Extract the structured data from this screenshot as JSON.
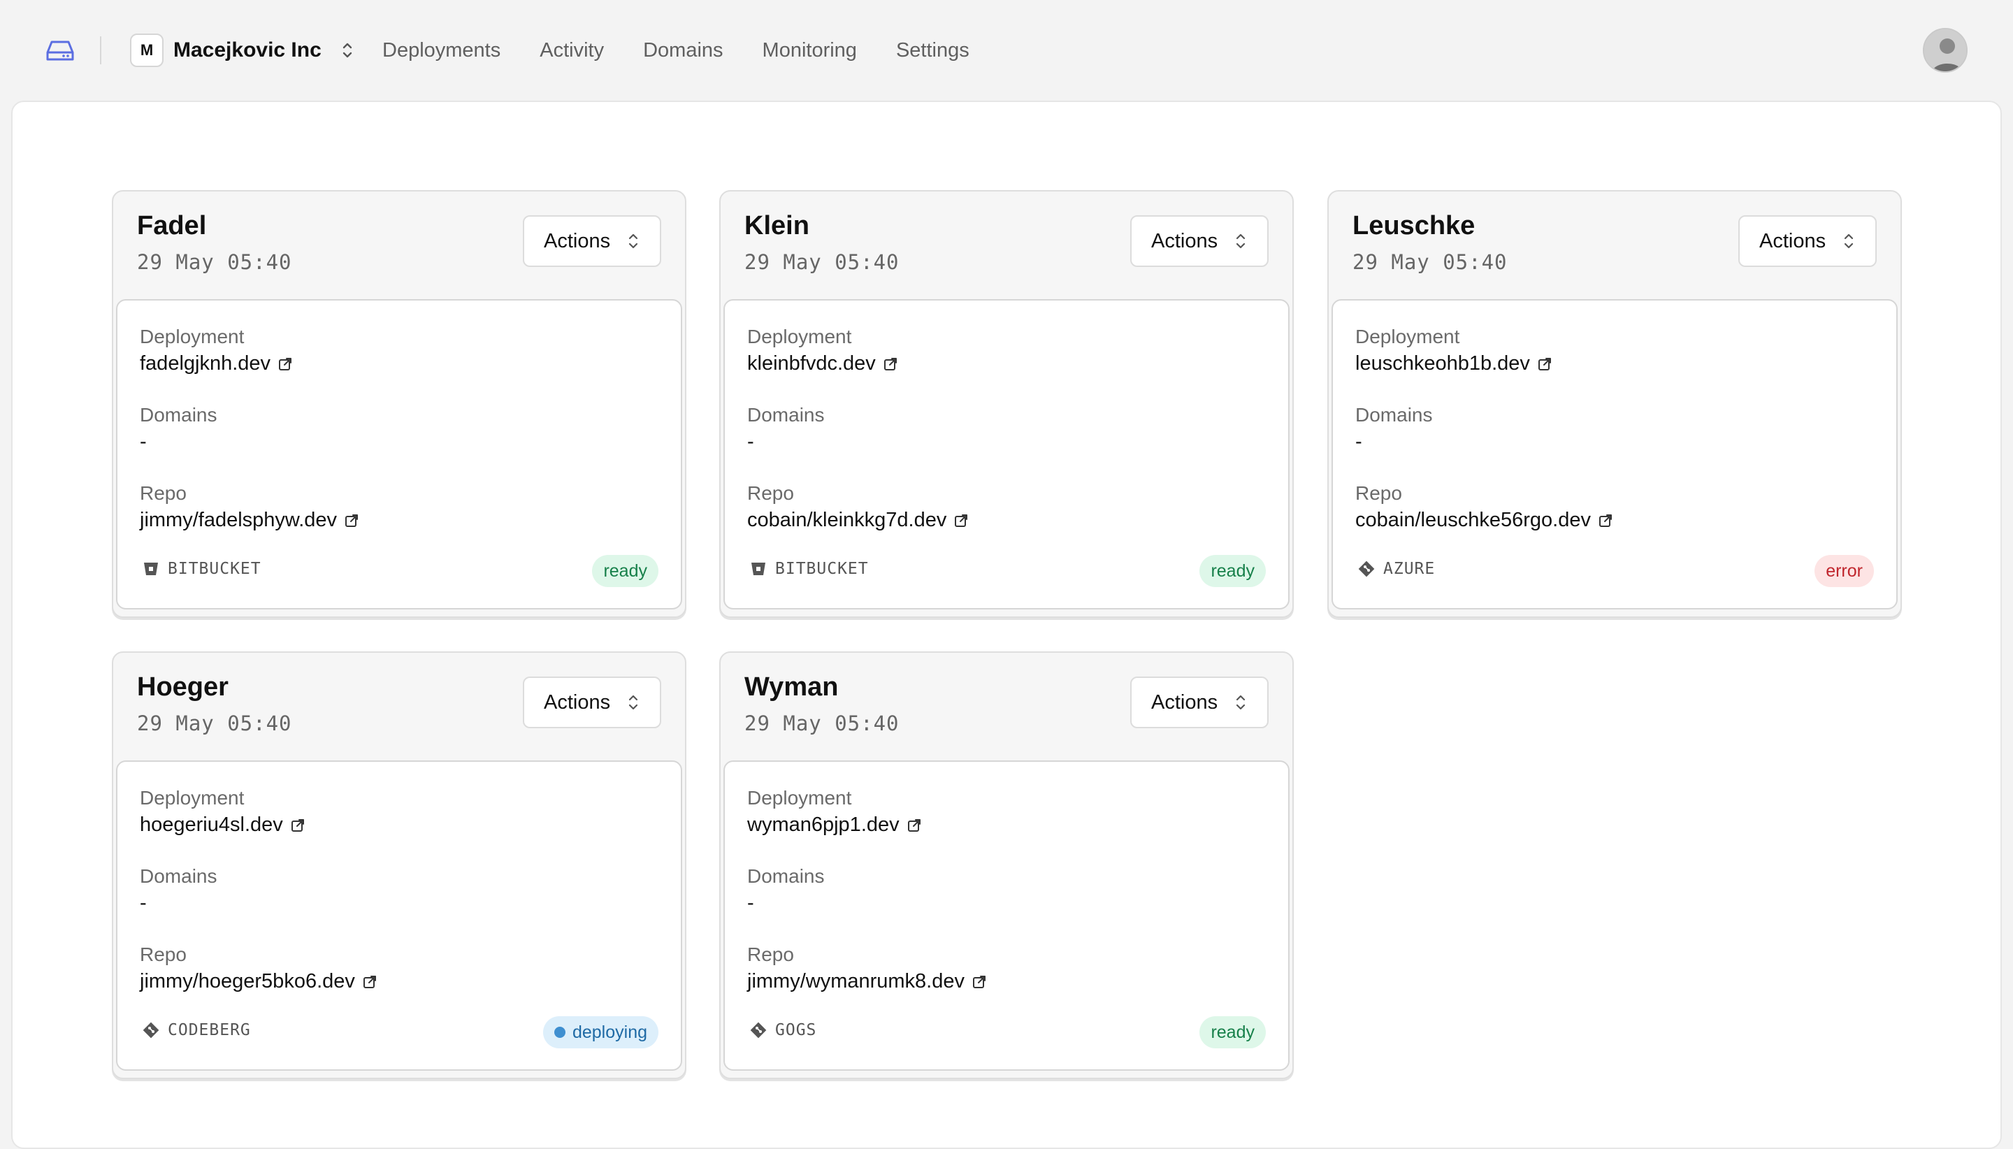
{
  "org": {
    "initial": "M",
    "name": "Macejkovic Inc"
  },
  "nav": [
    "Deployments",
    "Activity",
    "Domains",
    "Monitoring",
    "Settings"
  ],
  "labels": {
    "deployment": "Deployment",
    "domains": "Domains",
    "repo": "Repo",
    "actions": "Actions"
  },
  "projects": [
    {
      "name": "Fadel",
      "date": "29 May 05:40",
      "deployment": "fadelgjknh.dev",
      "domains": "-",
      "repo": "jimmy/fadelsphyw.dev",
      "provider": "BITBUCKET",
      "provider_icon": "bitbucket-icon",
      "status": "ready"
    },
    {
      "name": "Klein",
      "date": "29 May 05:40",
      "deployment": "kleinbfvdc.dev",
      "domains": "-",
      "repo": "cobain/kleinkkg7d.dev",
      "provider": "BITBUCKET",
      "provider_icon": "bitbucket-icon",
      "status": "ready"
    },
    {
      "name": "Leuschke",
      "date": "29 May 05:40",
      "deployment": "leuschkeohb1b.dev",
      "domains": "-",
      "repo": "cobain/leuschke56rgo.dev",
      "provider": "AZURE",
      "provider_icon": "git-icon",
      "status": "error"
    },
    {
      "name": "Hoeger",
      "date": "29 May 05:40",
      "deployment": "hoegeriu4sl.dev",
      "domains": "-",
      "repo": "jimmy/hoeger5bko6.dev",
      "provider": "CODEBERG",
      "provider_icon": "git-icon",
      "status": "deploying"
    },
    {
      "name": "Wyman",
      "date": "29 May 05:40",
      "deployment": "wyman6pjp1.dev",
      "domains": "-",
      "repo": "jimmy/wymanrumk8.dev",
      "provider": "GOGS",
      "provider_icon": "git-icon",
      "status": "ready"
    }
  ],
  "colors": {
    "ready_bg": "#def7e9",
    "ready_fg": "#17804a",
    "error_bg": "#fde4e4",
    "error_fg": "#c0262d",
    "deploying_bg": "#ddeffb",
    "deploying_fg": "#1f6aa5",
    "logo": "#5b6ee1"
  }
}
